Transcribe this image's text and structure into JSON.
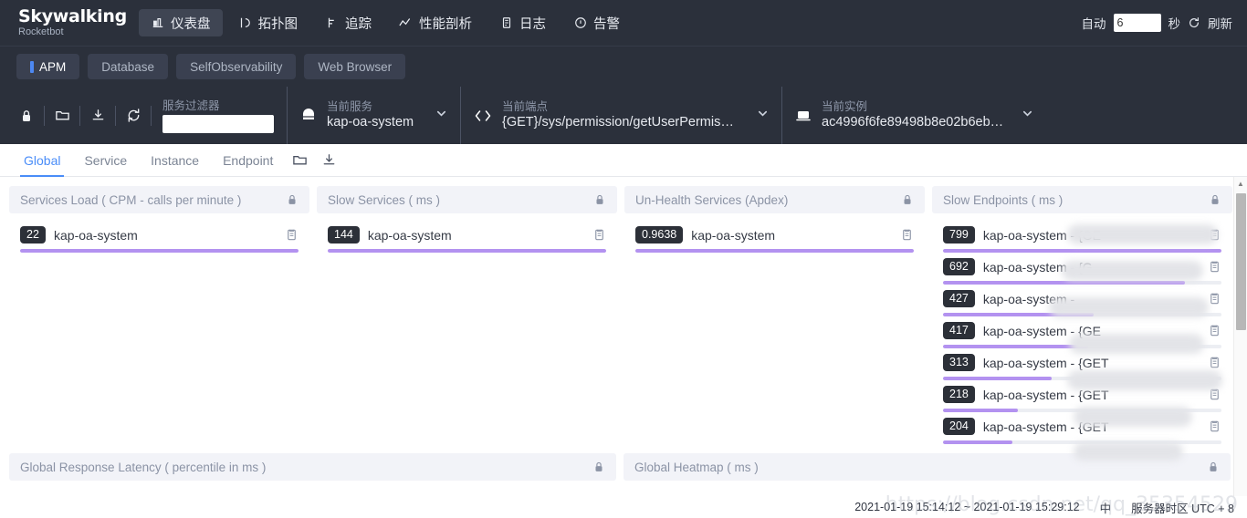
{
  "topnav": {
    "logo_main": "Skywalking",
    "logo_sub": "Rocketbot",
    "items": [
      {
        "label": "仪表盘",
        "icon": "dashboard-icon",
        "active": true
      },
      {
        "label": "拓扑图",
        "icon": "topology-icon",
        "active": false
      },
      {
        "label": "追踪",
        "icon": "trace-icon",
        "active": false
      },
      {
        "label": "性能剖析",
        "icon": "profile-icon",
        "active": false
      },
      {
        "label": "日志",
        "icon": "log-icon",
        "active": false
      },
      {
        "label": "告警",
        "icon": "alarm-icon",
        "active": false
      }
    ],
    "auto_label": "自动",
    "auto_value": "6",
    "seconds_label": "秒",
    "refresh_label": "刷新",
    "refresh_icon": "refresh-icon"
  },
  "typebar": {
    "items": [
      {
        "label": "APM",
        "active": true
      },
      {
        "label": "Database",
        "active": false
      },
      {
        "label": "SelfObservability",
        "active": false
      },
      {
        "label": "Web Browser",
        "active": false
      }
    ]
  },
  "selectorbar": {
    "tool_icons": [
      "lock-icon",
      "folder-icon",
      "download-icon",
      "reload-icon"
    ],
    "filter": {
      "label": "服务过滤器",
      "value": "",
      "placeholder": ""
    },
    "service": {
      "label": "当前服务",
      "value": "kap-oa-system",
      "icon": "service-icon"
    },
    "endpoint": {
      "label": "当前端点",
      "value": "{GET}/sys/permission/getUserPermissi...",
      "icon": "endpoint-icon"
    },
    "instance": {
      "label": "当前实例",
      "value": "ac4996f6fe89498b8e02b6ebf5...",
      "icon": "instance-icon"
    }
  },
  "subtabs": {
    "items": [
      {
        "label": "Global",
        "active": true
      },
      {
        "label": "Service",
        "active": false
      },
      {
        "label": "Instance",
        "active": false
      },
      {
        "label": "Endpoint",
        "active": false
      }
    ],
    "icons": [
      "folder-icon",
      "download-icon"
    ]
  },
  "theme": {
    "accent_blue": "#4a8df8",
    "bar_purple": "#b392f0",
    "badge_dark": "#2c3038",
    "header_bg": "#f2f3f8",
    "nav_bg": "#2b303b"
  },
  "cards": [
    {
      "title": "Services Load ( CPM - calls per minute )",
      "lock_icon": "lock-icon",
      "rows": [
        {
          "value": "22",
          "name": "kap-oa-system",
          "pct": 100,
          "redacted": false
        }
      ]
    },
    {
      "title": "Slow Services ( ms )",
      "lock_icon": "lock-icon",
      "rows": [
        {
          "value": "144",
          "name": "kap-oa-system",
          "pct": 100,
          "redacted": false
        }
      ]
    },
    {
      "title": "Un-Health Services (Apdex)",
      "lock_icon": "lock-icon",
      "rows": [
        {
          "value": "0.9638",
          "name": "kap-oa-system",
          "pct": 100,
          "redacted": false
        }
      ]
    },
    {
      "title": "Slow Endpoints ( ms )",
      "lock_icon": "lock-icon",
      "rows": [
        {
          "value": "799",
          "name": "kap-oa-system - {GE",
          "pct": 100,
          "redacted": true
        },
        {
          "value": "692",
          "name": "kap-oa-system - {G",
          "pct": 87,
          "redacted": true
        },
        {
          "value": "427",
          "name": "kap-oa-system - ",
          "pct": 54,
          "redacted": true
        },
        {
          "value": "417",
          "name": "kap-oa-system - {GE",
          "pct": 52,
          "redacted": true
        },
        {
          "value": "313",
          "name": "kap-oa-system - {GET",
          "pct": 39,
          "redacted": true
        },
        {
          "value": "218",
          "name": "kap-oa-system - {GET",
          "pct": 27,
          "redacted": true
        },
        {
          "value": "204",
          "name": "kap-oa-system - {GET",
          "pct": 25,
          "redacted": true
        }
      ]
    }
  ],
  "bottom_cards": [
    {
      "title": "Global Response Latency ( percentile in ms )",
      "lock_icon": "lock-icon"
    },
    {
      "title": "Global Heatmap ( ms )",
      "lock_icon": "lock-icon"
    }
  ],
  "footer": {
    "time_range": "2021-01-19 15:14:12 ~ 2021-01-19 15:29:12",
    "lang": "中",
    "timezone": "服务器时区 UTC + 8",
    "watermark": "https://blog.csdn.net/qq_35354529"
  },
  "scrollbar": {
    "up": "▲",
    "down": "▼"
  }
}
